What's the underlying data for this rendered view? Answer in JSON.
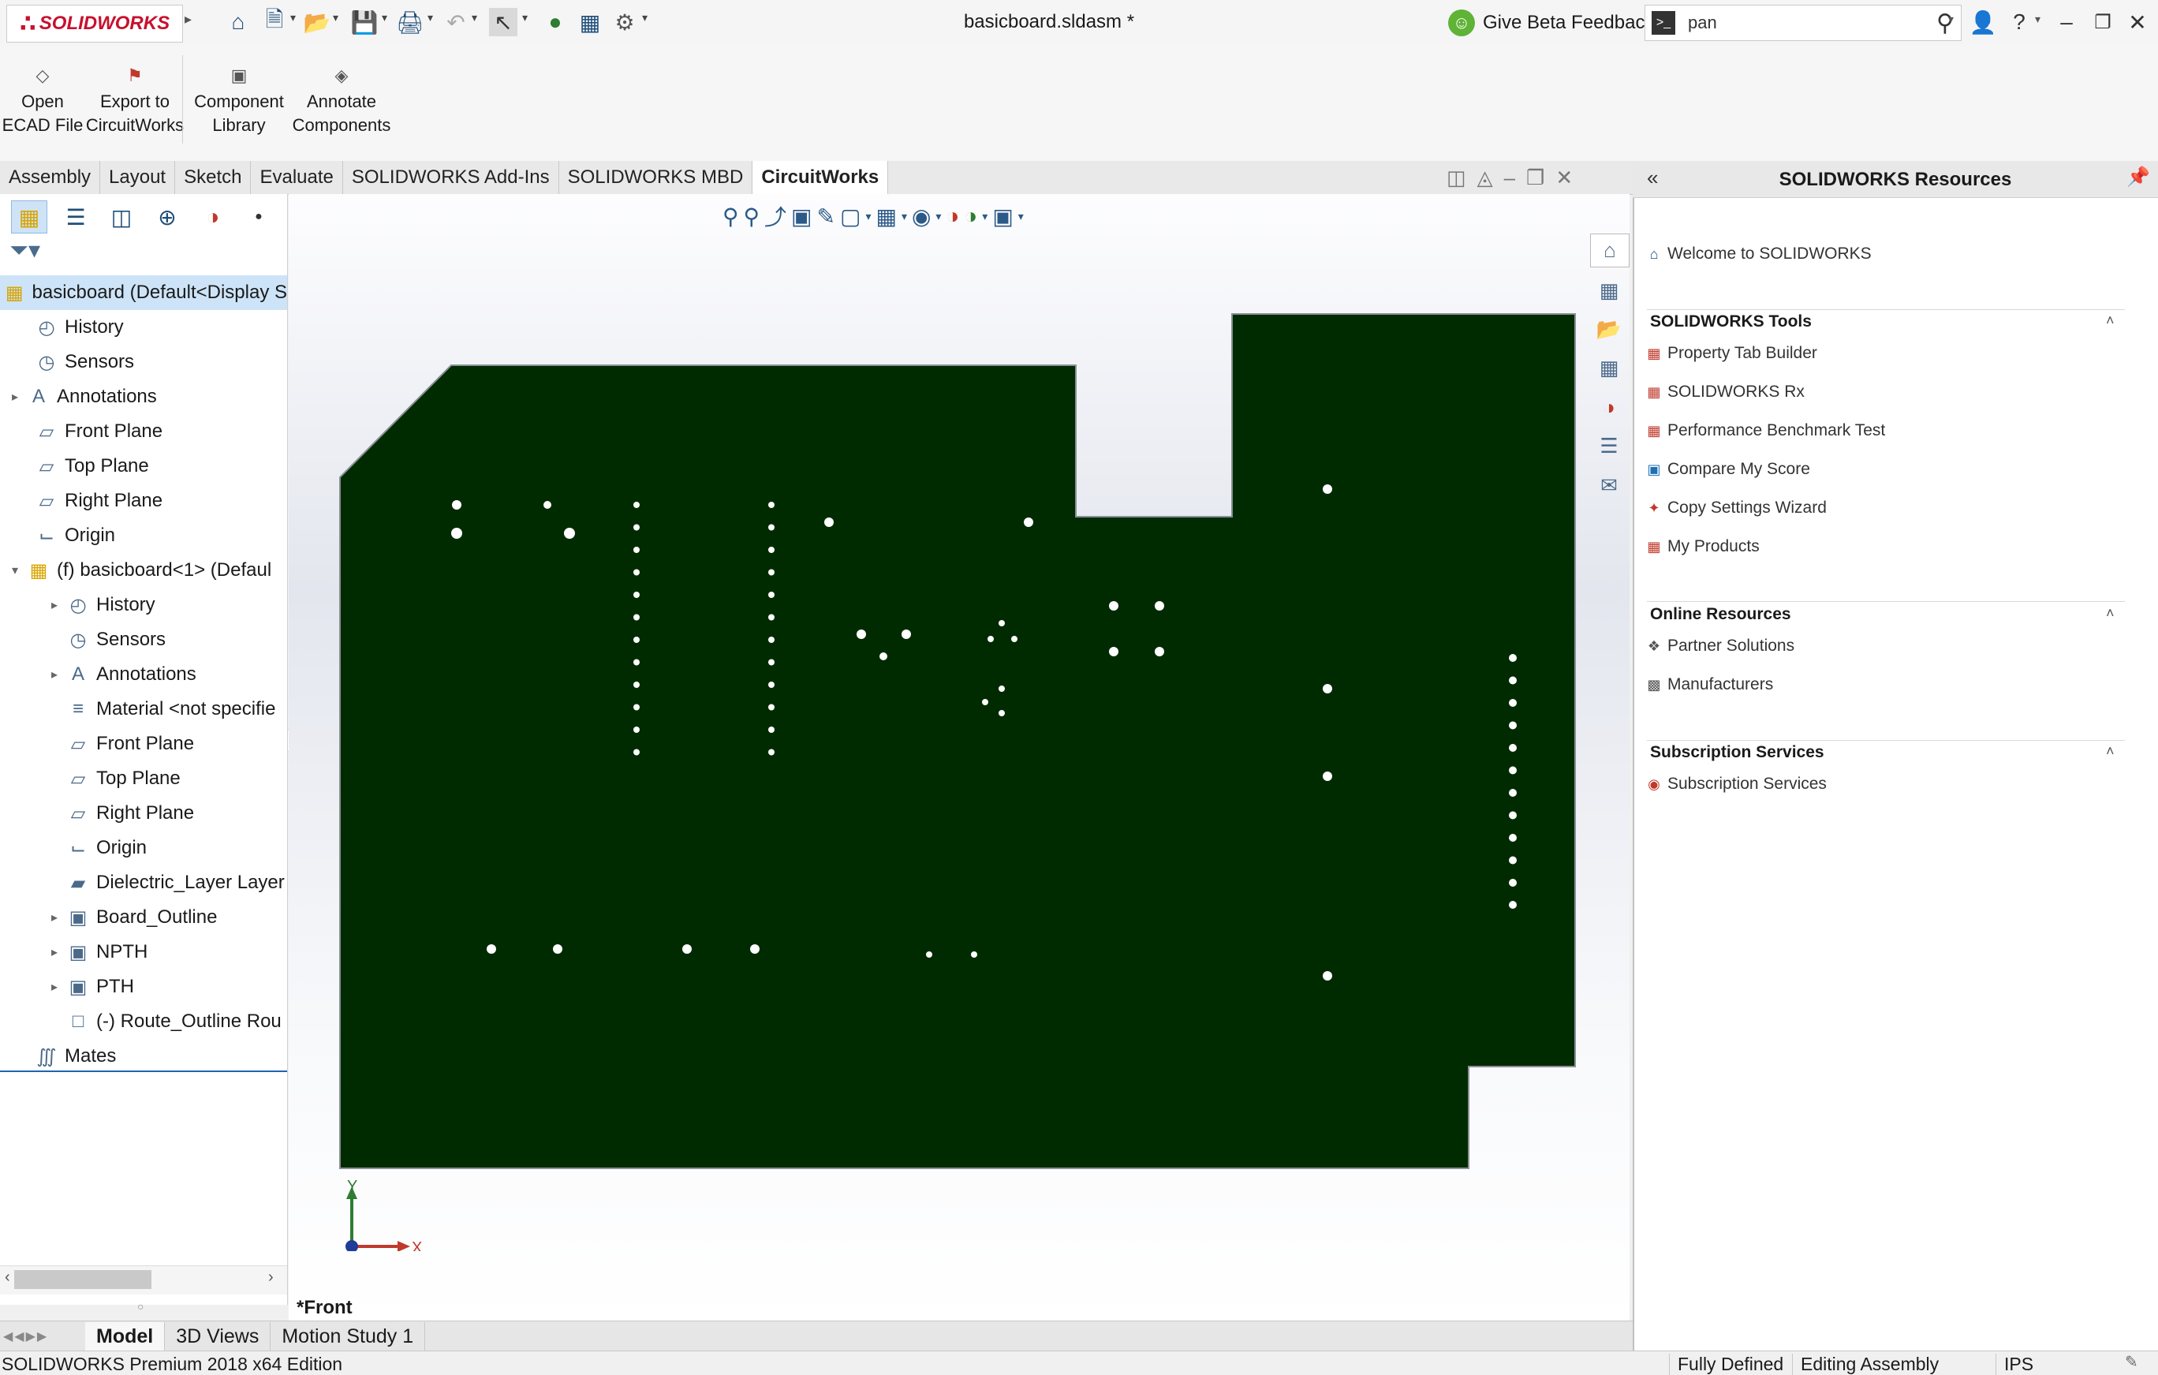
{
  "app": {
    "logo": "SOLIDWORKS",
    "doc_title": "basicboard.sldasm *",
    "beta_feedback": "Give Beta Feedback",
    "search_value": "pan"
  },
  "command_manager": {
    "buttons": [
      {
        "line1": "Open",
        "line2": "ECAD File"
      },
      {
        "line1": "Export to",
        "line2": "CircuitWorks"
      },
      {
        "line1": "Component",
        "line2": "Library"
      },
      {
        "line1": "Annotate",
        "line2": "Components"
      }
    ]
  },
  "tabs": [
    "Assembly",
    "Layout",
    "Sketch",
    "Evaluate",
    "SOLIDWORKS Add-Ins",
    "SOLIDWORKS MBD",
    "CircuitWorks"
  ],
  "active_tab": "CircuitWorks",
  "tree": {
    "root": "basicboard  (Default<Display S",
    "items": [
      "History",
      "Sensors",
      "Annotations",
      "Front Plane",
      "Top Plane",
      "Right Plane",
      "Origin",
      "(f) basicboard<1> (Defaul",
      "History",
      "Sensors",
      "Annotations",
      "Material <not specifie",
      "Front Plane",
      "Top Plane",
      "Right Plane",
      "Origin",
      "Dielectric_Layer Layer",
      "Board_Outline",
      "NPTH",
      "PTH",
      "(-) Route_Outline Rou",
      "Mates"
    ]
  },
  "viewport": {
    "view_name": "*Front",
    "axis_x": "X",
    "axis_y": "Y",
    "board_color": "#002b00"
  },
  "resources": {
    "title": "SOLIDWORKS Resources",
    "welcome": "Welcome to SOLIDWORKS",
    "sections": [
      {
        "title": "SOLIDWORKS Tools",
        "items": [
          "Property Tab Builder",
          "SOLIDWORKS Rx",
          "Performance Benchmark Test",
          "Compare My Score",
          "Copy Settings Wizard",
          "My Products"
        ]
      },
      {
        "title": "Online Resources",
        "items": [
          "Partner Solutions",
          "Manufacturers"
        ]
      },
      {
        "title": "Subscription Services",
        "items": [
          "Subscription Services"
        ]
      }
    ]
  },
  "bottom_tabs": [
    "Model",
    "3D Views",
    "Motion Study 1"
  ],
  "status": {
    "edition": "SOLIDWORKS Premium 2018 x64 Edition",
    "state": "Fully Defined",
    "mode": "Editing Assembly",
    "units": "IPS"
  }
}
